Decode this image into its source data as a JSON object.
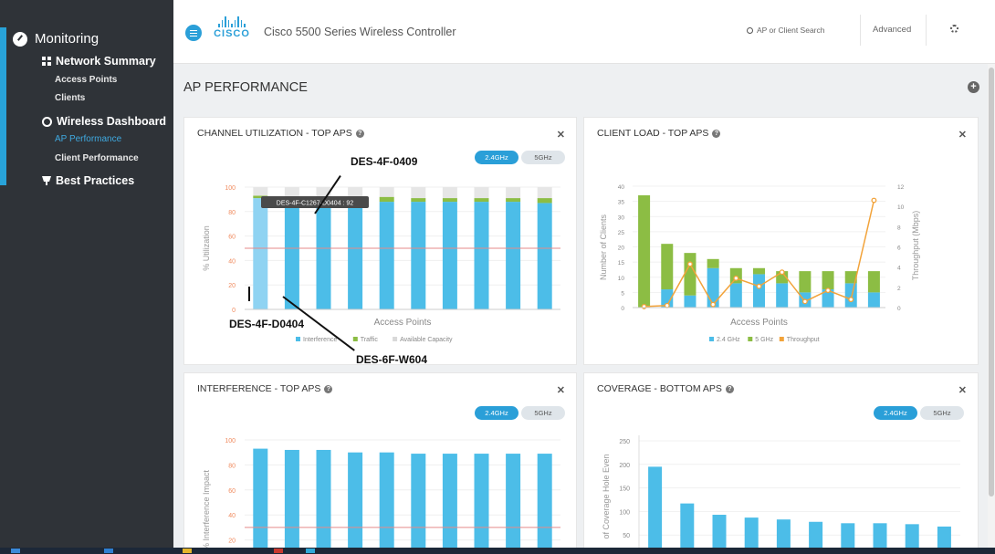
{
  "sidebar": {
    "monitoring": "Monitoring",
    "network_summary": "Network Summary",
    "access_points": "Access Points",
    "clients": "Clients",
    "wireless_dashboard": "Wireless Dashboard",
    "ap_performance": "AP Performance",
    "client_performance": "Client Performance",
    "best_practices": "Best Practices"
  },
  "header": {
    "logo_text": "CISCO",
    "app_title": "Cisco 5500 Series Wireless Controller",
    "search_placeholder": "AP or Client Search",
    "advanced": "Advanced"
  },
  "page": {
    "title": "AP PERFORMANCE"
  },
  "panels": {
    "channel": {
      "title": "CHANNEL UTILIZATION - TOP APS",
      "toggle_24": "2.4GHz",
      "toggle_5": "5GHz",
      "tooltip": "DES-4F-C1267-D0404 : 92"
    },
    "client_load": {
      "title": "CLIENT LOAD - TOP APS"
    },
    "interference": {
      "title": "INTERFERENCE - TOP APS",
      "toggle_24": "2.4GHz",
      "toggle_5": "5GHz"
    },
    "coverage": {
      "title": "COVERAGE - BOTTOM APS",
      "toggle_24": "2.4GHz",
      "toggle_5": "5GHz"
    }
  },
  "annotations": {
    "a1": "DES-4F-0409",
    "a2": "DES-4F-D0404",
    "a3": "DES-6F-W604"
  },
  "colors": {
    "blue": "#4cbde8",
    "light_blue": "#8fd3f2",
    "green": "#8cbd44",
    "orange": "#f2a33a",
    "grey": "#e6e6e6",
    "red_line": "#e58a8a"
  },
  "chart_data": [
    {
      "type": "bar",
      "title": "CHANNEL UTILIZATION - TOP APS",
      "xlabel": "Access Points",
      "ylabel": "% Utilization",
      "ylim": [
        0,
        100
      ],
      "yticks": [
        0,
        20,
        40,
        60,
        80,
        100
      ],
      "threshold": 50,
      "stacked": true,
      "series": [
        {
          "name": "Interference",
          "values": [
            91,
            89,
            89,
            89,
            88,
            88,
            88,
            88,
            88,
            87
          ]
        },
        {
          "name": "Traffic",
          "values": [
            2,
            3,
            3,
            3,
            4,
            3,
            3,
            3,
            3,
            4
          ]
        },
        {
          "name": "Available Capacity",
          "values": [
            7,
            8,
            8,
            8,
            8,
            9,
            9,
            9,
            9,
            9
          ]
        }
      ],
      "legend_position": "bottom"
    },
    {
      "type": "bar",
      "title": "CLIENT LOAD - TOP APS",
      "xlabel": "Access Points",
      "ylabel": "Number of Clients",
      "y2label": "Throughput (Mbps)",
      "ylim": [
        0,
        40
      ],
      "yticks": [
        0,
        5,
        10,
        15,
        20,
        25,
        30,
        35,
        40
      ],
      "y2lim": [
        0,
        12
      ],
      "y2ticks": [
        0,
        2,
        4,
        6,
        8,
        10,
        12
      ],
      "stacked": true,
      "series": [
        {
          "name": "2.4 GHz",
          "values": [
            0,
            6,
            4,
            13,
            8,
            11,
            8,
            5,
            6,
            8,
            5
          ]
        },
        {
          "name": "5 GHz",
          "values": [
            37,
            15,
            14,
            3,
            5,
            2,
            4,
            7,
            6,
            4,
            7
          ]
        },
        {
          "name": "Throughput",
          "type": "line",
          "values": [
            0.1,
            0.2,
            4.3,
            0.3,
            2.9,
            2.1,
            3.5,
            0.6,
            1.7,
            0.8,
            10.6
          ]
        }
      ],
      "legend_position": "bottom"
    },
    {
      "type": "bar",
      "title": "INTERFERENCE - TOP APS",
      "ylabel": "% Interference Impact",
      "ylim": [
        0,
        100
      ],
      "yticks": [
        20,
        40,
        60,
        80,
        100
      ],
      "threshold": 30,
      "values": [
        93,
        92,
        92,
        90,
        90,
        89,
        89,
        89,
        89,
        89
      ]
    },
    {
      "type": "bar",
      "title": "COVERAGE - BOTTOM APS",
      "ylabel": "of Coverage Hole Even",
      "ylim": [
        0,
        250
      ],
      "yticks": [
        50,
        100,
        150,
        200,
        250
      ],
      "values": [
        195,
        117,
        93,
        87,
        83,
        78,
        75,
        75,
        73,
        68
      ]
    }
  ]
}
